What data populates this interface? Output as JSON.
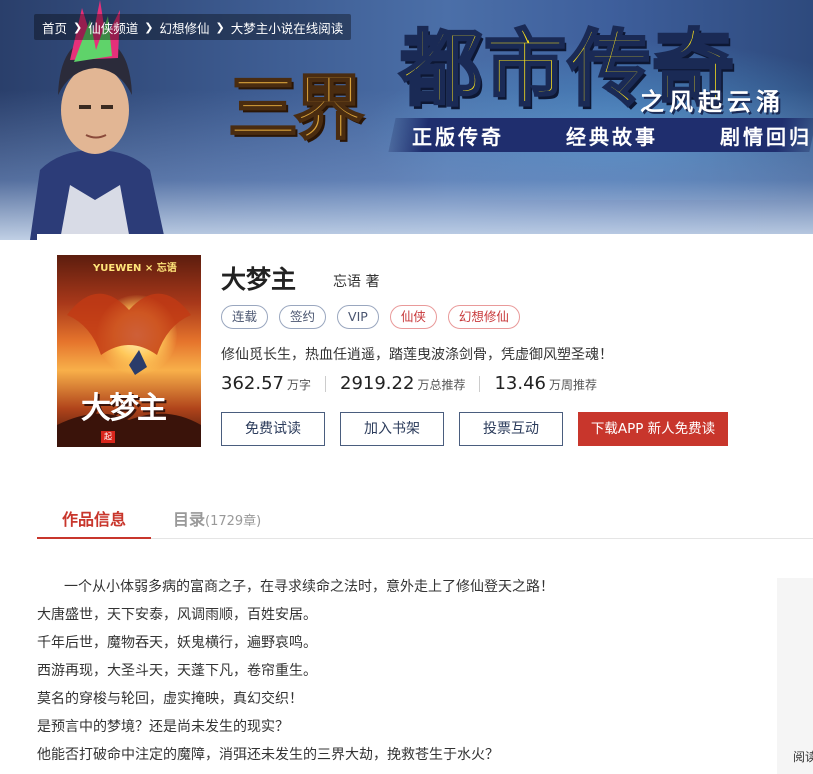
{
  "breadcrumb": [
    "首页",
    "仙侠频道",
    "幻想修仙",
    "大梦主小说在线阅读"
  ],
  "banner": {
    "logo": "三界",
    "title": "都市传奇",
    "subtitle": "之风起云涌",
    "tags": [
      "正版传奇",
      "经典故事",
      "剧情回归"
    ]
  },
  "cover": {
    "brand": "YUEWEN × 忘语",
    "title": "大梦主",
    "badge": "起"
  },
  "book": {
    "title": "大梦主",
    "author": "忘语 著",
    "tags": [
      "连载",
      "签约",
      "VIP"
    ],
    "categories": [
      "仙侠",
      "幻想修仙"
    ],
    "intro": "修仙觅长生，热血任逍遥，踏莲曳波涤剑骨，凭虚御风塑圣魂！",
    "stats": [
      {
        "value": "362.57",
        "unit": "万字"
      },
      {
        "value": "2919.22",
        "unit": "万总推荐"
      },
      {
        "value": "13.46",
        "unit": "万周推荐"
      }
    ],
    "buttons": {
      "trial": "免费试读",
      "shelf": "加入书架",
      "vote": "投票互动",
      "download": "下载APP 新人免费读"
    }
  },
  "tabs": {
    "info": "作品信息",
    "toc": "目录",
    "toc_count": "(1729章)"
  },
  "synopsis": [
    "一个从小体弱多病的富商之子，在寻求续命之法时，意外走上了修仙登天之路！",
    "大唐盛世，天下安泰，风调雨顺，百姓安居。",
    "千年后世，魔物吞天，妖鬼横行，遍野哀鸣。",
    "西游再现，大圣斗天，天蓬下凡，卷帘重生。",
    "莫名的穿梭与轮回，虚实掩映，真幻交织！",
    "是预言中的梦境？还是尚未发生的现实？",
    "他能否打破命中注定的魔障，消弭还未发生的三界大劫，挽救苍生于水火？"
  ],
  "side": {
    "label": "阅读"
  },
  "colors": {
    "accent": "#c8362c",
    "banner_title": "#ffe51a",
    "tag_border": "#9aa7bf"
  }
}
